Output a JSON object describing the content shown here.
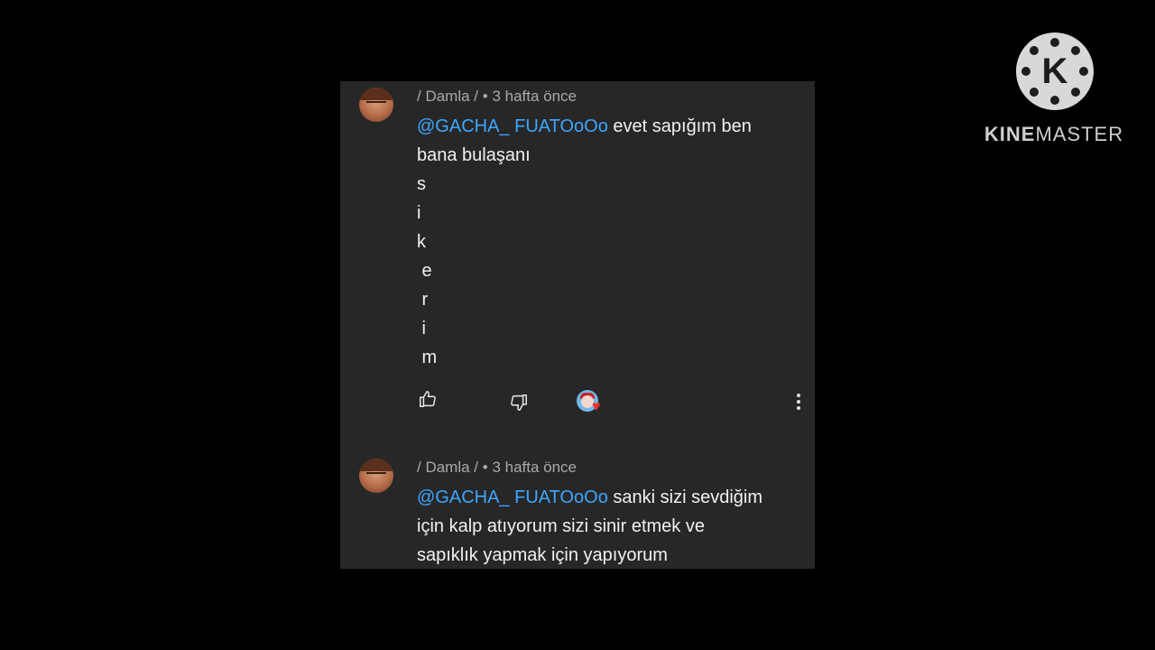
{
  "comments": [
    {
      "author": "/ Damla /",
      "meta_sep": " • ",
      "time": "3 hafta önce",
      "mention": "@GACHA_ FUATOoOo",
      "lines": [
        " evet sapığım ben",
        "bana bulaşanı",
        "s",
        "i",
        "k",
        " e",
        " r",
        " i",
        " m"
      ],
      "icons": {
        "like": "thumbs-up-icon",
        "dislike": "thumbs-down-icon",
        "creator_heart": "creator-heart-icon",
        "more": "more-vertical-icon"
      }
    },
    {
      "author": "/ Damla /",
      "meta_sep": " • ",
      "time": "3 hafta önce",
      "mention": "@GACHA_ FUATOoOo",
      "lines": [
        " sanki sizi sevdiğim",
        "için kalp atıyorum sizi sinir etmek ve",
        "sapıklık yapmak için yapıyorum"
      ]
    }
  ],
  "watermark": {
    "logo_letter": "K",
    "brand_bold": "KINE",
    "brand_light": "MASTER"
  },
  "colors": {
    "background": "#000000",
    "panel": "#272727",
    "mention": "#3ea6ff",
    "text": "#f1f1f1",
    "meta": "#aaaaaa",
    "heart": "#ff2a2a"
  }
}
